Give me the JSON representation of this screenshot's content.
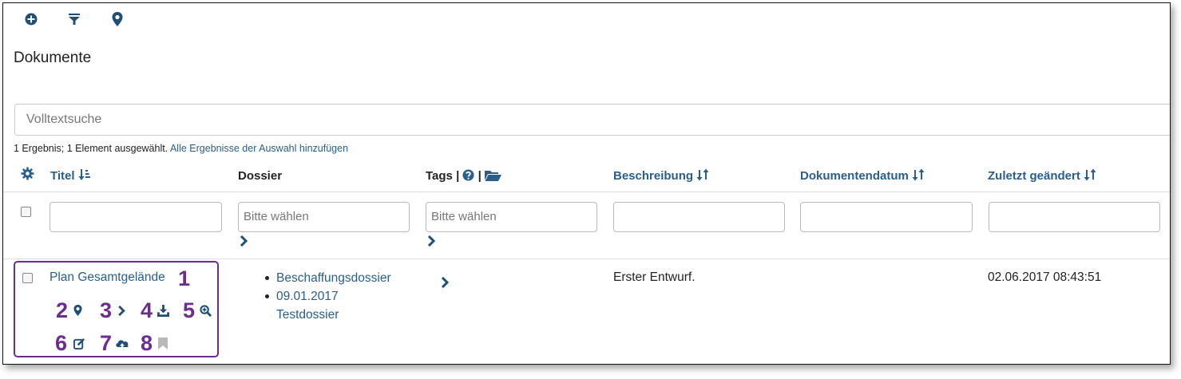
{
  "toolbar": {
    "icons": [
      "plus-circle-icon",
      "filter-icon",
      "map-marker-icon"
    ]
  },
  "page": {
    "title": "Dokumente"
  },
  "search": {
    "placeholder": "Volltextsuche"
  },
  "result_info": {
    "text": "1 Ergebnis; 1 Element ausgewählt.",
    "link": "Alle Ergebnisse der Auswahl hinzufügen"
  },
  "table": {
    "columns": {
      "titel": "Titel",
      "dossier": "Dossier",
      "tags": "Tags |",
      "tags_sep": "|",
      "beschreibung": "Beschreibung",
      "dokumentendatum": "Dokumentendatum",
      "zuletzt": "Zuletzt geändert"
    },
    "filters": {
      "dossier_placeholder": "Bitte wählen",
      "tags_placeholder": "Bitte wählen"
    },
    "rows": [
      {
        "titel": "Plan Gesamtgelände",
        "dossiers": [
          "Beschaffungsdossier",
          "09.01.2017",
          "Testdossier"
        ],
        "beschreibung": "Erster Entwurf.",
        "dokumentendatum": "",
        "zuletzt": "02.06.2017 08:43:51"
      }
    ]
  },
  "annotations": {
    "n1": "1",
    "n2": "2",
    "n3": "3",
    "n4": "4",
    "n5": "5",
    "n6": "6",
    "n7": "7",
    "n8": "8"
  },
  "colors": {
    "link": "#2a5e8c",
    "annotation": "#6b2d8f"
  }
}
